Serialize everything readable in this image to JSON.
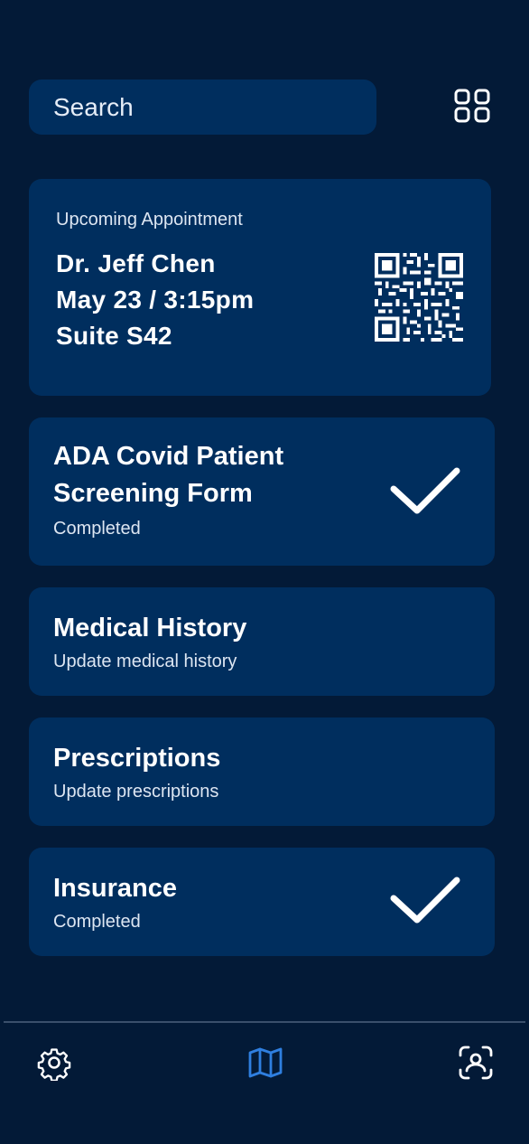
{
  "search": {
    "placeholder": "Search"
  },
  "appointment": {
    "label": "Upcoming Appointment",
    "doctor": "Dr. Jeff Chen",
    "datetime": "May 23 / 3:15pm",
    "location": "Suite S42"
  },
  "tasks": [
    {
      "title_line1": "ADA Covid Patient",
      "title_line2": "Screening Form",
      "subtitle": "Completed",
      "completed": true
    },
    {
      "title": "Medical History",
      "subtitle": "Update medical history",
      "completed": false
    },
    {
      "title": "Prescriptions",
      "subtitle": "Update prescriptions",
      "completed": false
    },
    {
      "title": "Insurance",
      "subtitle": "Completed",
      "completed": true
    }
  ],
  "nav": {
    "items": [
      {
        "icon": "gear-icon",
        "active": false
      },
      {
        "icon": "map-icon",
        "active": true
      },
      {
        "icon": "scan-face-icon",
        "active": false
      }
    ]
  },
  "colors": {
    "background": "#031A37",
    "card": "#002E5E",
    "active_icon": "#2F7FE0",
    "text": "#FFFFFF"
  }
}
